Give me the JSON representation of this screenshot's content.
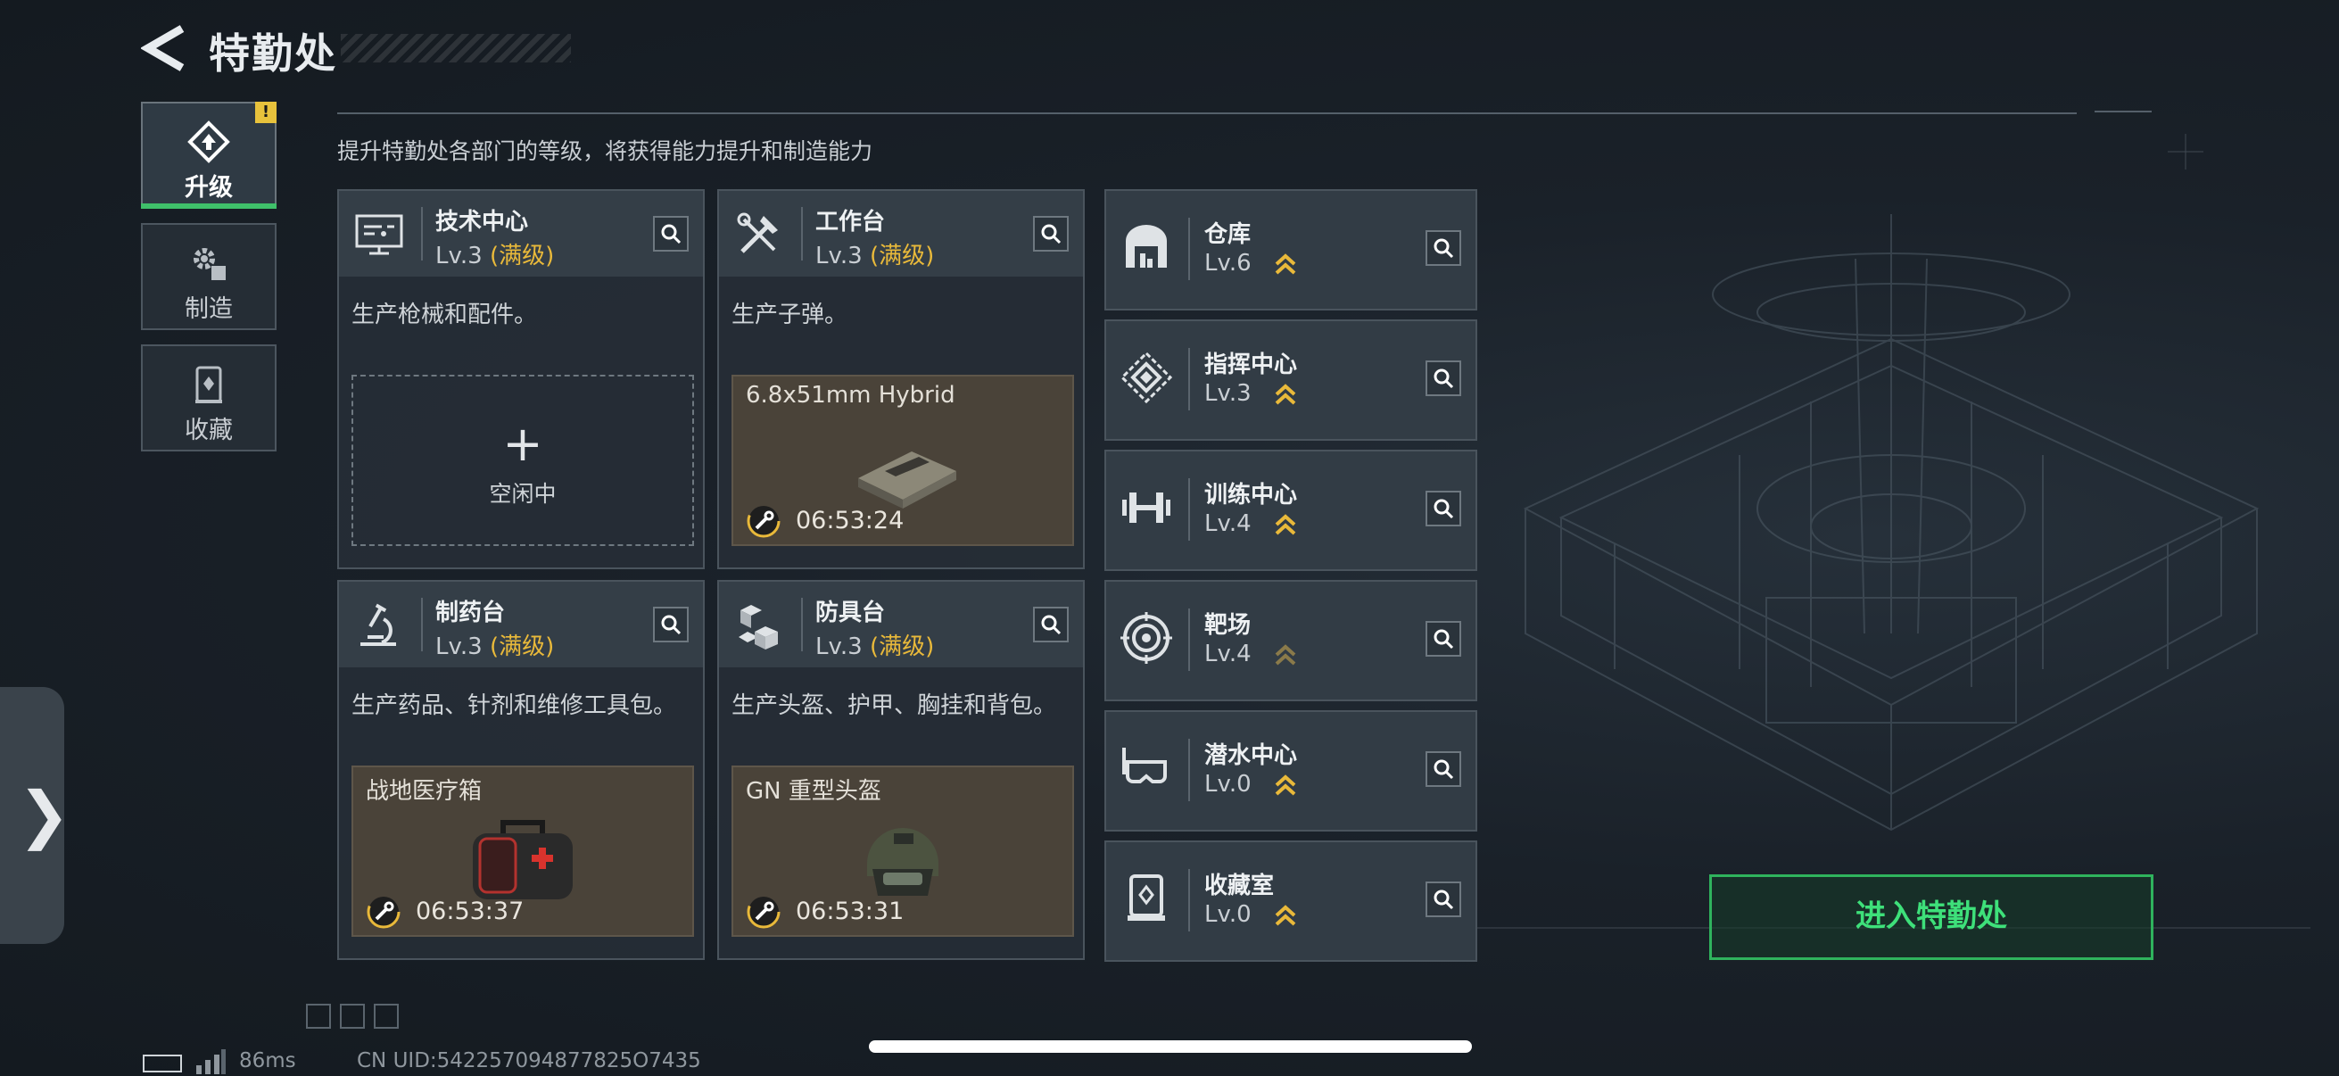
{
  "header": {
    "title": "特勤处"
  },
  "subtitle": "提升特勤处各部门的等级，将获得能力提升和制造能力",
  "sidebar": {
    "items": [
      {
        "label": "升级",
        "icon": "upgrade-icon",
        "active": true,
        "badge": "!"
      },
      {
        "label": "制造",
        "icon": "gears-icon",
        "active": false
      },
      {
        "label": "收藏",
        "icon": "collection-icon",
        "active": false
      }
    ]
  },
  "cards": [
    {
      "name": "技术中心",
      "level": "Lv.3",
      "max": "(满级)",
      "icon": "monitor-icon",
      "desc": "生产枪械和配件。",
      "slot": {
        "state": "idle",
        "label": "空闲中"
      }
    },
    {
      "name": "工作台",
      "level": "Lv.3",
      "max": "(满级)",
      "icon": "tools-icon",
      "desc": "生产子弹。",
      "slot": {
        "state": "busy",
        "item": "6.8x51mm Hybrid",
        "timer": "06:53:24"
      }
    },
    {
      "name": "制药台",
      "level": "Lv.3",
      "max": "(满级)",
      "icon": "microscope-icon",
      "desc": "生产药品、针剂和维修工具包。",
      "slot": {
        "state": "busy",
        "item": "战地医疗箱",
        "timer": "06:53:37"
      }
    },
    {
      "name": "防具台",
      "level": "Lv.3",
      "max": "(满级)",
      "icon": "armor-blocks-icon",
      "desc": "生产头盔、护甲、胸挂和背包。",
      "slot": {
        "state": "busy",
        "item": "GN 重型头盔",
        "timer": "06:53:31"
      }
    }
  ],
  "facilities": [
    {
      "name": "仓库",
      "level": "Lv.6",
      "icon": "warehouse-icon"
    },
    {
      "name": "指挥中心",
      "level": "Lv.3",
      "icon": "command-icon"
    },
    {
      "name": "训练中心",
      "level": "Lv.4",
      "icon": "dumbbell-icon"
    },
    {
      "name": "靶场",
      "level": "Lv.4",
      "icon": "target-icon"
    },
    {
      "name": "潜水中心",
      "level": "Lv.0",
      "icon": "diving-mask-icon"
    },
    {
      "name": "收藏室",
      "level": "Lv.0",
      "icon": "display-case-icon"
    }
  ],
  "enter_button": "进入特勤处",
  "footer": {
    "ping": "86ms",
    "uid": "CN UID:542257094877825O7435"
  },
  "colors": {
    "accent_green": "#3ee07a",
    "max_gold": "#e9b93a",
    "badge_yellow": "#e8c23c"
  }
}
